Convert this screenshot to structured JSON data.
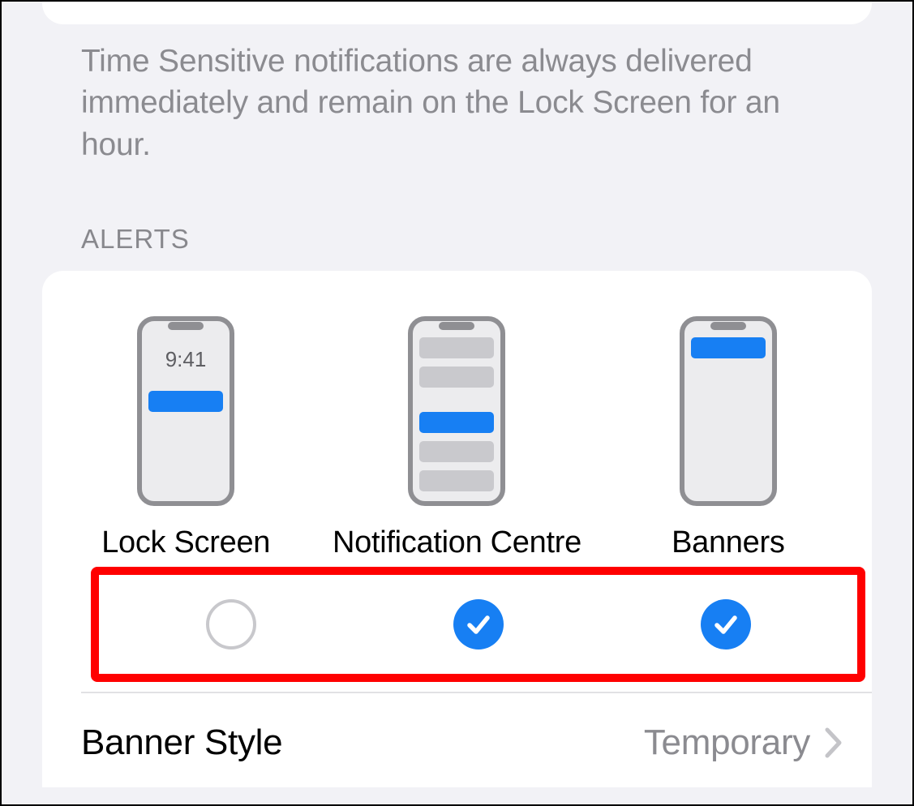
{
  "description_text": "Time Sensitive notifications are always delivered immediately and remain on the Lock Screen for an hour.",
  "section_header": "ALERTS",
  "lockscreen_time": "9:41",
  "alerts": {
    "options": [
      {
        "label": "Lock Screen",
        "checked": false
      },
      {
        "label": "Notification Centre",
        "checked": true
      },
      {
        "label": "Banners",
        "checked": true
      }
    ]
  },
  "banner_style": {
    "label": "Banner Style",
    "value": "Temporary"
  },
  "colors": {
    "accent": "#177ff3",
    "bg": "#f2f2f6",
    "secondary_text": "#8b8b90",
    "highlight": "#ff0000"
  }
}
